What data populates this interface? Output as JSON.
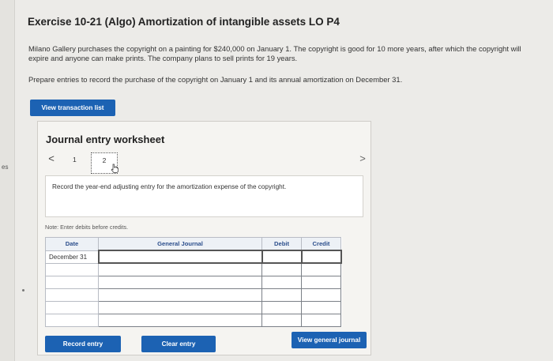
{
  "left_panel": {
    "partial_text": "es"
  },
  "header": {
    "title": "Exercise 10-21 (Algo) Amortization of intangible assets LO P4"
  },
  "problem": {
    "description": "Milano Gallery purchases the copyright on a painting for $240,000 on January 1. The copyright is good for 10 more years, after which the copyright will expire and anyone can make prints. The company plans to sell prints for 19 years.",
    "instruction": "Prepare entries to record the purchase of the copyright on January 1 and its annual amortization on December 31."
  },
  "buttons": {
    "view_transaction_list": "View transaction list",
    "record_entry": "Record entry",
    "clear_entry": "Clear entry",
    "view_general_journal": "View general journal"
  },
  "worksheet": {
    "title": "Journal entry worksheet",
    "pager": {
      "prev": "<",
      "page_1": "1",
      "page_2": "2",
      "next": ">"
    },
    "task": "Record the year-end adjusting entry for the amortization expense of the copyright.",
    "note": "Note: Enter debits before credits.",
    "table": {
      "headers": {
        "date": "Date",
        "general_journal": "General Journal",
        "debit": "Debit",
        "credit": "Credit"
      },
      "date_value": "December 31"
    }
  },
  "colors": {
    "button_blue": "#1c62b3",
    "header_text": "#2b4e8c"
  }
}
